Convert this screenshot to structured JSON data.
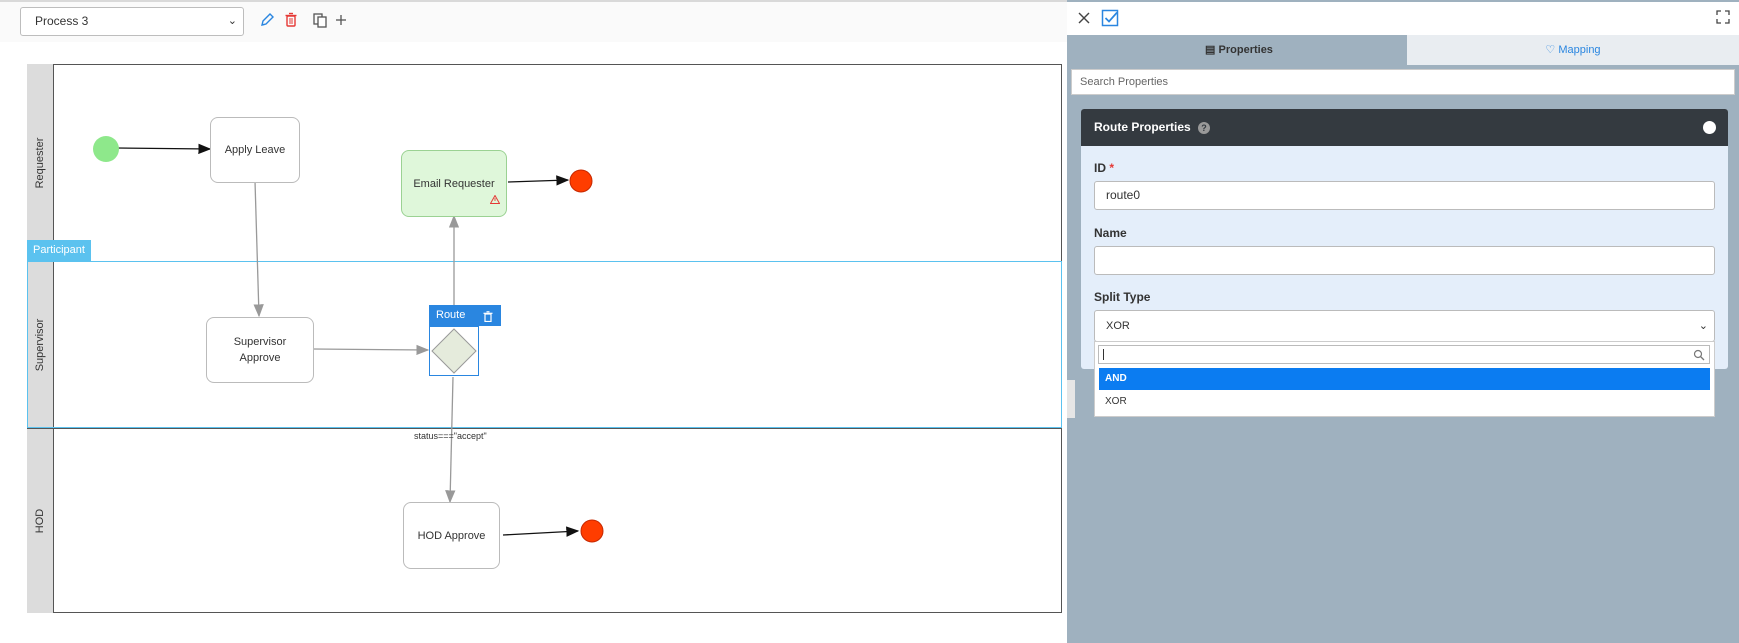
{
  "toolbar": {
    "process_value": "Process 3",
    "icons": [
      "edit-icon",
      "trash-icon",
      "copy-icon",
      "plus-icon"
    ]
  },
  "canvas": {
    "lanes": [
      "Requester",
      "Supervisor",
      "HOD"
    ],
    "participant_tag": "Participant",
    "tasks": {
      "apply_leave": "Apply Leave",
      "email_requester": "Email Requester",
      "supervisor_approve_1": "Supervisor",
      "supervisor_approve_2": "Approve",
      "hod_approve": "HOD Approve"
    },
    "route_label": "Route",
    "condition_label": "status===\"accept\""
  },
  "panel": {
    "tabs": {
      "properties": "Properties",
      "mapping": "Mapping"
    },
    "search_placeholder": "Search Properties",
    "card_title": "Route Properties",
    "id_label": "ID",
    "id_required": "*",
    "id_value": "route0",
    "name_label": "Name",
    "name_value": "",
    "split_type_label": "Split Type",
    "split_type_value": "XOR",
    "split_options": [
      "AND",
      "XOR"
    ],
    "selected_option": "AND"
  },
  "colors": {
    "start_event": "#8ee88b",
    "end_event": "#ff3d00",
    "selected_blue": "#2a86e0",
    "participant_blue": "#5bc2ef",
    "panel_bg": "#9fb1bf",
    "card_header": "#343a40",
    "option_highlight": "#0b7cf1",
    "email_task_fill": "#dff7da"
  }
}
